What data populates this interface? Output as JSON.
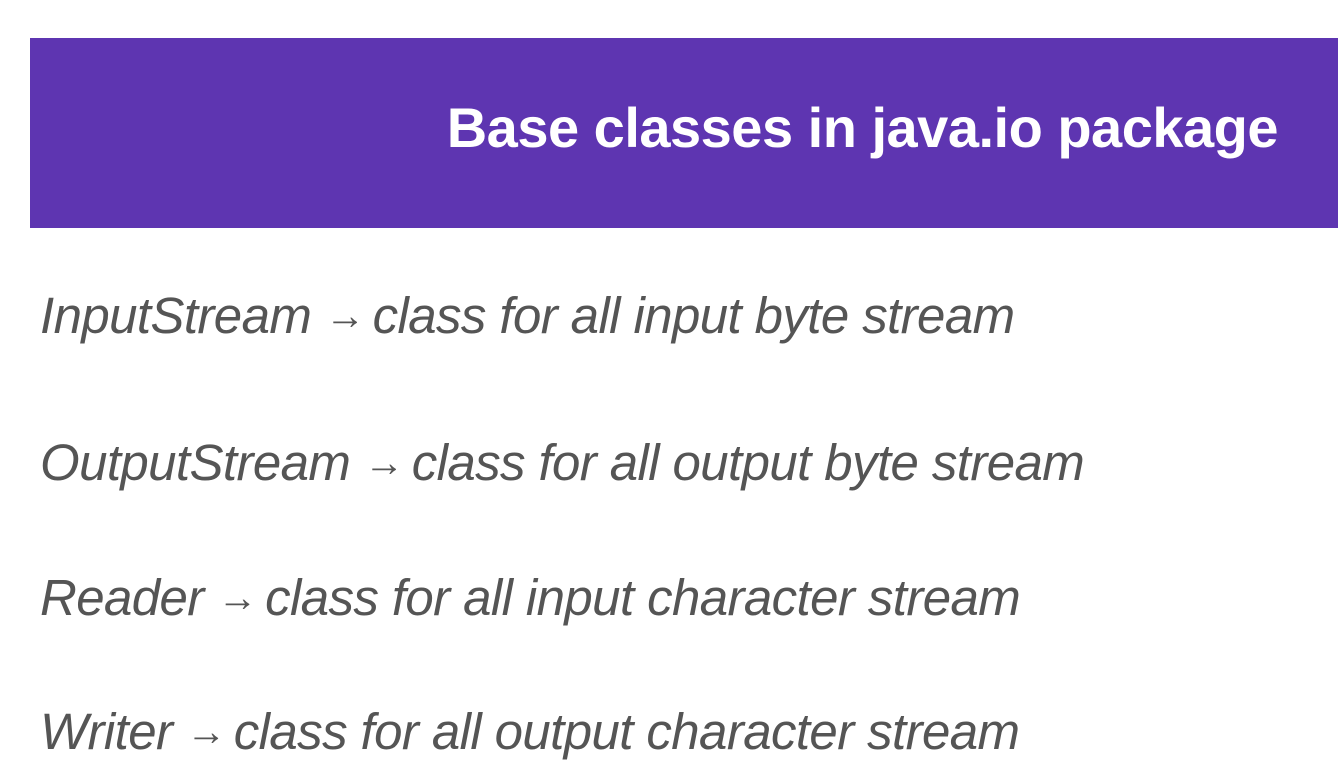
{
  "slide": {
    "title": "Base classes in java.io package",
    "accent_color": "#5e35b1",
    "text_color": "#555555",
    "items": [
      {
        "name": "InputStream",
        "arrow": "→",
        "description": "class for all input byte stream"
      },
      {
        "name": "OutputStream",
        "arrow": "→",
        "description": "class for all output byte stream"
      },
      {
        "name": "Reader",
        "arrow": "→",
        "description": "class for all input character stream"
      },
      {
        "name": "Writer",
        "arrow": "→",
        "description": "class for all output character stream"
      }
    ]
  }
}
